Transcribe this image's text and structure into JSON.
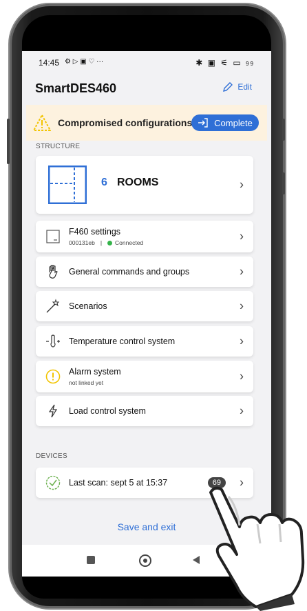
{
  "status": {
    "time": "14:45",
    "left_icons": "⚙ ▷ ▣ ♡ ···",
    "right_icons": "✱ ▣ ⚟ ▭",
    "battery": "99"
  },
  "app": {
    "title": "SmartDES460",
    "edit_label": "Edit"
  },
  "banner": {
    "text": "Compromised configurations",
    "button": "Complete"
  },
  "sections": {
    "structure": "STRUCTURE",
    "devices": "DEVICES"
  },
  "rooms": {
    "count": "6",
    "label": "ROOMS"
  },
  "items": [
    {
      "label": "F460 settings",
      "sub_id": "000131eb",
      "sub_sep": "|",
      "sub_status": "Connected",
      "icon": "device-icon"
    },
    {
      "label": "General commands and groups",
      "icon": "hand-icon"
    },
    {
      "label": "Scenarios",
      "icon": "magic-wand-icon"
    },
    {
      "label": "Temperature control system",
      "icon": "thermometer-icon"
    },
    {
      "label": "Alarm system",
      "sub": "not linked yet",
      "icon": "alert-icon"
    },
    {
      "label": "Load control system",
      "icon": "lightning-icon"
    }
  ],
  "devices": {
    "last_scan": "Last scan: sept 5 at 15:37",
    "count": "69"
  },
  "footer": {
    "save": "Save and exit"
  },
  "colors": {
    "accent": "#2f6fd6",
    "warning": "#f2c400",
    "connected": "#34b34a",
    "banner_bg": "#fdf2df"
  }
}
